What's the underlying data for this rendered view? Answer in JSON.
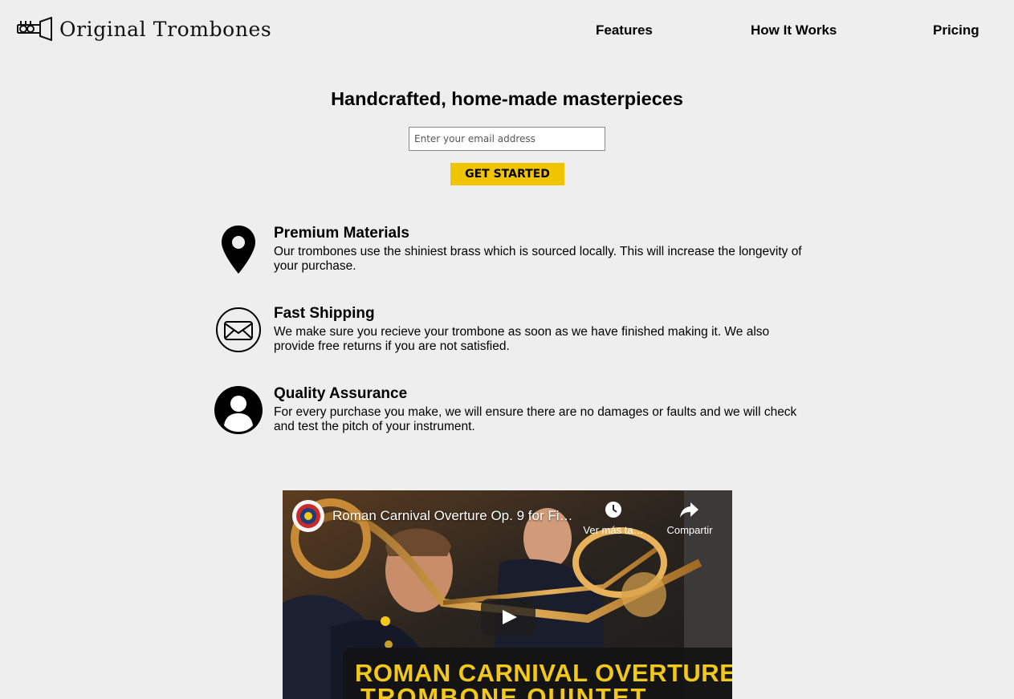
{
  "header": {
    "logo_text": "Original Trombones",
    "logo_icon": "trombone-icon",
    "nav": [
      {
        "label": "Features"
      },
      {
        "label": "How It Works"
      },
      {
        "label": "Pricing"
      }
    ]
  },
  "hero": {
    "title": "Handcrafted, home-made masterpieces",
    "email_placeholder": "Enter your email address",
    "cta_label": "GET STARTED",
    "cta_color": "#f0c400"
  },
  "features": [
    {
      "icon": "map-pin-icon",
      "title": "Premium Materials",
      "text": "Our trombones use the shiniest brass which is sourced locally. This will increase the longevity of your purchase."
    },
    {
      "icon": "envelope-icon",
      "title": "Fast Shipping",
      "text": "We make sure you recieve your trombone as soon as we have finished making it. We also provide free returns if you are not satisfied."
    },
    {
      "icon": "user-icon",
      "title": "Quality Assurance",
      "text": "For every purchase you make, we will ensure there are no damages or faults and we will check and test the pitch of your instrument."
    }
  ],
  "video": {
    "title": "Roman Carnival Overture Op. 9 for Fi…",
    "watch_later_label": "Ver más ta…",
    "share_label": "Compartir",
    "banner_line1": "ROMAN CARNIVAL OVERTURE",
    "banner_line2": "TROMBONE QUINTET",
    "banner_color": "#f2c81a"
  }
}
